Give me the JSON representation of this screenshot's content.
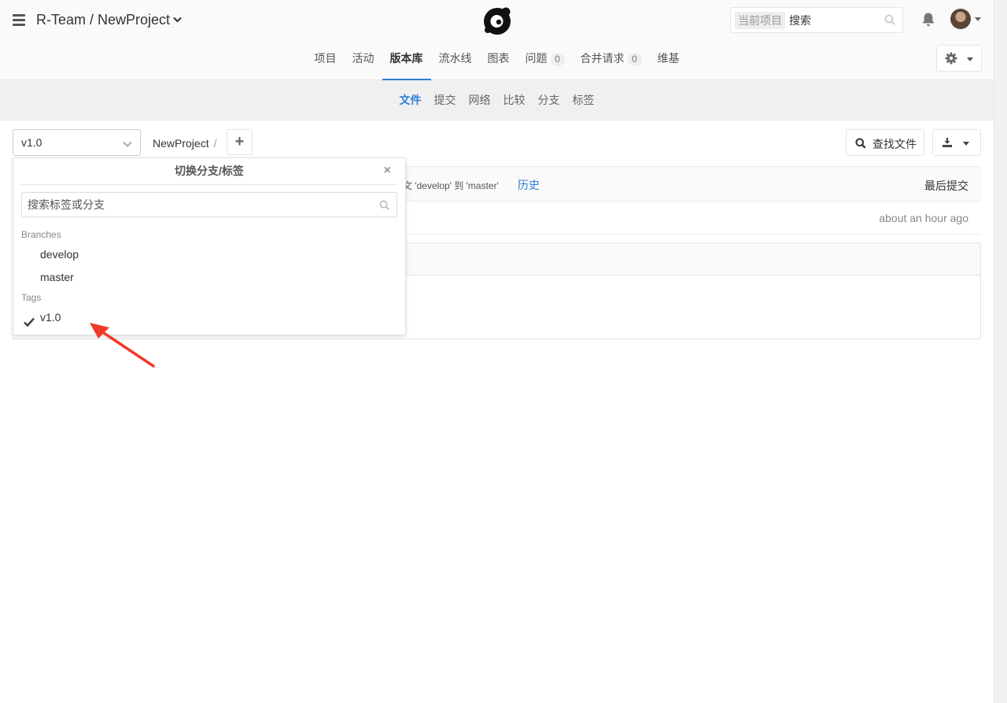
{
  "header": {
    "project_path": "R-Team / NewProject",
    "search_scope": "当前项目",
    "search_value": "搜索"
  },
  "nav_tabs": [
    {
      "label": "项目",
      "active": false
    },
    {
      "label": "活动",
      "active": false
    },
    {
      "label": "版本库",
      "active": true
    },
    {
      "label": "流水线",
      "active": false
    },
    {
      "label": "图表",
      "active": false
    },
    {
      "label": "问题",
      "active": false,
      "badge": "0"
    },
    {
      "label": "合并请求",
      "active": false,
      "badge": "0"
    },
    {
      "label": "维基",
      "active": false
    }
  ],
  "sub_tabs": [
    {
      "label": "文件",
      "active": true
    },
    {
      "label": "提交",
      "active": false
    },
    {
      "label": "网络",
      "active": false
    },
    {
      "label": "比较",
      "active": false
    },
    {
      "label": "分支",
      "active": false
    },
    {
      "label": "标签",
      "active": false
    }
  ],
  "toolbar": {
    "ref_value": "v1.0",
    "path_root": "NewProject",
    "path_separator": "/",
    "add_label": "+",
    "find_file_label": "查找文件"
  },
  "commit": {
    "message_fragment": "文 'develop' 到 'master'",
    "history_label": "历史",
    "last_commit_label": "最后提交",
    "time_ago": "about an hour ago"
  },
  "ref_dropdown": {
    "title": "切换分支/标签",
    "close_label": "×",
    "search_placeholder": "搜索标签或分支",
    "branches_header": "Branches",
    "branches": [
      "develop",
      "master"
    ],
    "tags_header": "Tags",
    "tags": [
      {
        "name": "v1.0",
        "selected": true
      }
    ]
  },
  "colors": {
    "accent": "#2f7ed8",
    "annotation_arrow": "#f03a2a"
  }
}
